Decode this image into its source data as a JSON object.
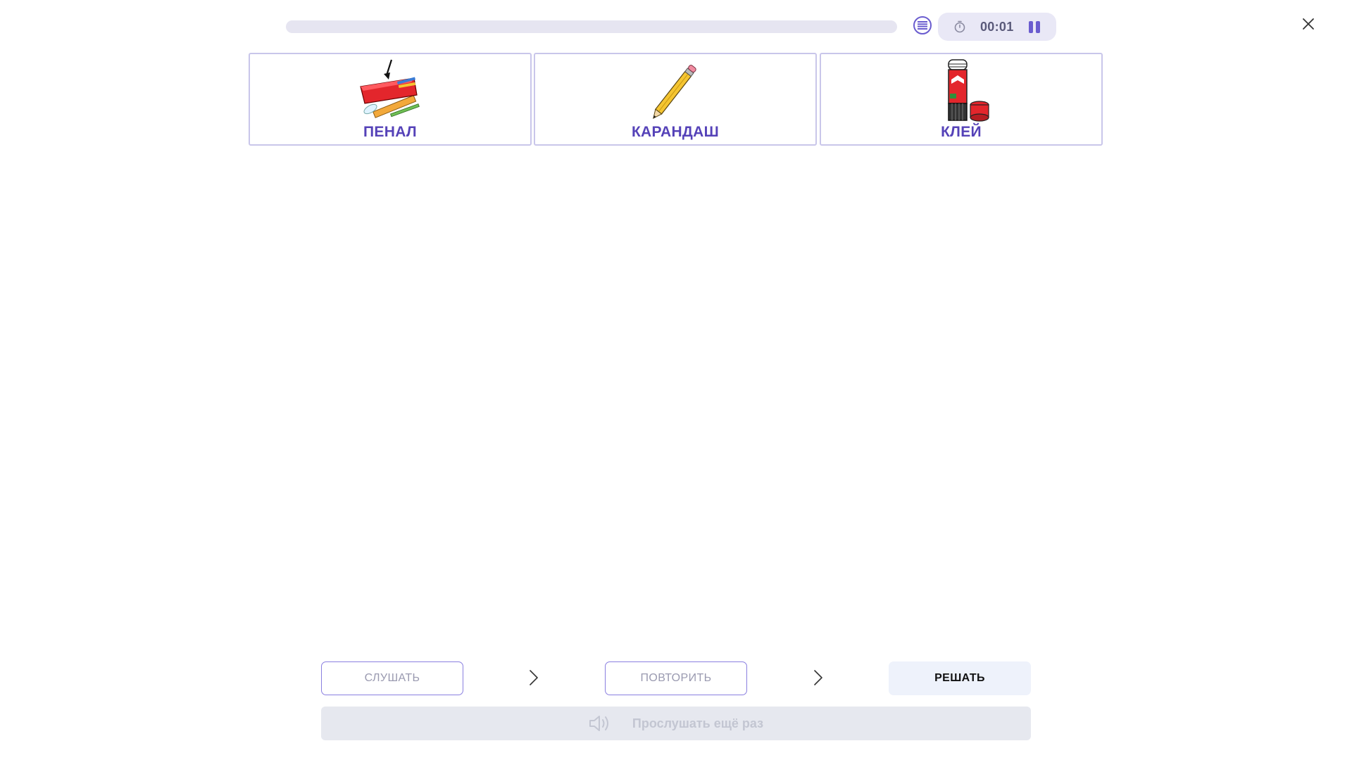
{
  "header": {
    "progress_fraction": 0,
    "timer": "00:01",
    "icons": {
      "menu": "list-menu-icon",
      "clock": "stopwatch-icon",
      "pause": "pause-icon",
      "close": "close-icon"
    }
  },
  "cards": [
    {
      "label": "ПЕНАЛ",
      "icon": "pencil-case-icon"
    },
    {
      "label": "КАРАНДАШ",
      "icon": "pencil-icon"
    },
    {
      "label": "КЛЕЙ",
      "icon": "glue-stick-icon"
    }
  ],
  "steps": [
    {
      "label": "СЛУШАТЬ",
      "state": "outline"
    },
    {
      "label": "ПОВТОРИТЬ",
      "state": "outline"
    },
    {
      "label": "РЕШАТЬ",
      "state": "active"
    }
  ],
  "listen_again": {
    "label": "Прослушать ещё раз",
    "icon": "speaker-icon",
    "disabled": true
  },
  "colors": {
    "accent": "#6a5ccf",
    "card_label": "#5542b8",
    "card_border": "#c9c6ea"
  }
}
